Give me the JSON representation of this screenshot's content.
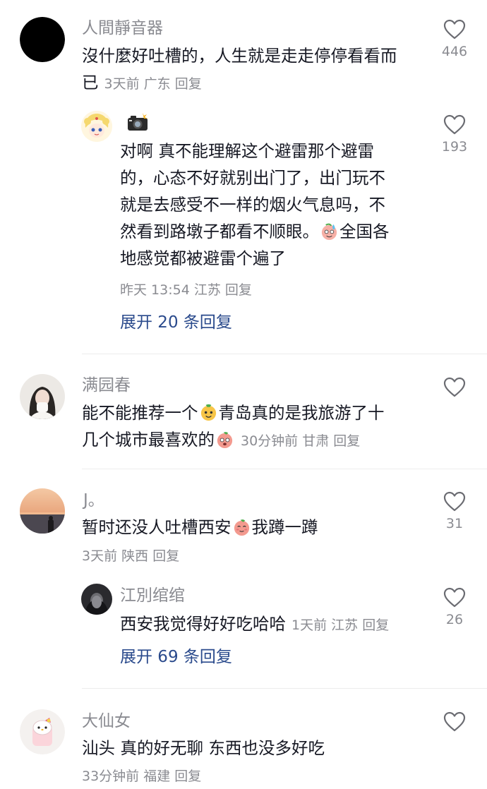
{
  "comments": [
    {
      "user": "人間靜音器",
      "lines": [
        "沒什麼好吐槽的，人生就是走走停停看看而",
        "已"
      ],
      "meta": {
        "time": "3天前",
        "location": "广东",
        "reply": "回复"
      },
      "likes": "446"
    },
    {
      "user": "",
      "lines": [
        "对啊 真不能理解这个避雷那个避雷",
        "的，心态不好就别出门了，出门玩不",
        "就是去感受不一样的烟火气息吗，不",
        "然看到路墩子都看不顺眼。",
        "全国各",
        "地感觉都被避雷个遍了"
      ],
      "meta": {
        "time": "昨天 13:54",
        "location": "江苏",
        "reply": "回复"
      },
      "likes": "193",
      "expand": "展开 20 条回复"
    },
    {
      "user": "满园春",
      "lines": [
        "能不能推荐一个",
        "青岛真的是我旅游了十",
        "几个城市最喜欢的"
      ],
      "meta": {
        "time": "30分钟前",
        "location": "甘肃",
        "reply": "回复"
      },
      "likes": ""
    },
    {
      "user": "J。",
      "lines": [
        "暂时还没人吐槽西安",
        "我蹲一蹲"
      ],
      "meta": {
        "time": "3天前",
        "location": "陕西",
        "reply": "回复"
      },
      "likes": "31"
    },
    {
      "user": "江別绾绾",
      "lines": [
        "西安我觉得好好吃哈哈"
      ],
      "meta": {
        "time": "1天前",
        "location": "江苏",
        "reply": "回复"
      },
      "likes": "26",
      "expand": "展开 69 条回复"
    },
    {
      "user": "大仙女",
      "lines": [
        "汕头 真的好无聊 东西也没多好吃"
      ],
      "meta": {
        "time": "33分钟前",
        "location": "福建",
        "reply": "回复"
      },
      "likes": ""
    }
  ],
  "icons": {
    "like": "heart-outline-icon",
    "camera": "camera-flash-icon",
    "emoji_sweat": "sweat-smile-emoji",
    "emoji_melon": "melon-smile-emoji",
    "emoji_peach": "peach-surprised-emoji",
    "emoji_peach2": "peach-shy-emoji"
  },
  "colors": {
    "text": "#161823",
    "secondary": "#8a8b91",
    "link": "#2a4a8c",
    "divider": "#ededed"
  }
}
